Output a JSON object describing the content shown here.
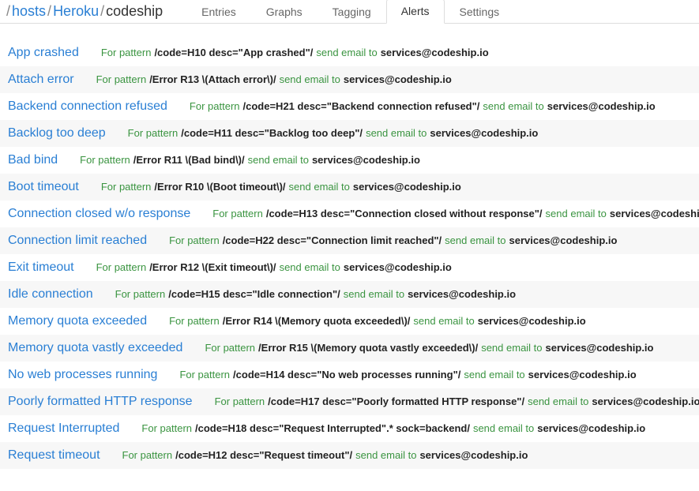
{
  "breadcrumb": {
    "slash": "/",
    "hosts": "hosts",
    "heroku": "Heroku",
    "current": "codeship"
  },
  "tabs": [
    {
      "label": "Entries"
    },
    {
      "label": "Graphs"
    },
    {
      "label": "Tagging"
    },
    {
      "label": "Alerts"
    },
    {
      "label": "Settings"
    }
  ],
  "labels": {
    "for_pattern": "For pattern",
    "send_email_to": "send email to"
  },
  "alerts": [
    {
      "name": "App crashed",
      "pattern": "/code=H10 desc=\"App crashed\"/",
      "email": "services@codeship.io"
    },
    {
      "name": "Attach error",
      "pattern": "/Error R13 \\(Attach error\\)/",
      "email": "services@codeship.io"
    },
    {
      "name": "Backend connection refused",
      "pattern": "/code=H21 desc=\"Backend connection refused\"/",
      "email": "services@codeship.io"
    },
    {
      "name": "Backlog too deep",
      "pattern": "/code=H11 desc=\"Backlog too deep\"/",
      "email": "services@codeship.io"
    },
    {
      "name": "Bad bind",
      "pattern": "/Error R11 \\(Bad bind\\)/",
      "email": "services@codeship.io"
    },
    {
      "name": "Boot timeout",
      "pattern": "/Error R10 \\(Boot timeout\\)/",
      "email": "services@codeship.io"
    },
    {
      "name": "Connection closed w/o response",
      "pattern": "/code=H13 desc=\"Connection closed without response\"/",
      "email": "services@codeship"
    },
    {
      "name": "Connection limit reached",
      "pattern": "/code=H22 desc=\"Connection limit reached\"/",
      "email": "services@codeship.io"
    },
    {
      "name": "Exit timeout",
      "pattern": "/Error R12 \\(Exit timeout\\)/",
      "email": "services@codeship.io"
    },
    {
      "name": "Idle connection",
      "pattern": "/code=H15 desc=\"Idle connection\"/",
      "email": "services@codeship.io"
    },
    {
      "name": "Memory quota exceeded",
      "pattern": "/Error R14 \\(Memory quota exceeded\\)/",
      "email": "services@codeship.io"
    },
    {
      "name": "Memory quota vastly exceeded",
      "pattern": "/Error R15 \\(Memory quota vastly exceeded\\)/",
      "email": "services@codeship.io"
    },
    {
      "name": "No web processes running",
      "pattern": "/code=H14 desc=\"No web processes running\"/",
      "email": "services@codeship.io"
    },
    {
      "name": "Poorly formatted HTTP response",
      "pattern": "/code=H17 desc=\"Poorly formatted HTTP response\"/",
      "email": "services@codeship.io"
    },
    {
      "name": "Request Interrupted",
      "pattern": "/code=H18 desc=\"Request Interrupted\".* sock=backend/",
      "email": "services@codeship.io"
    },
    {
      "name": "Request timeout",
      "pattern": "/code=H12 desc=\"Request timeout\"/",
      "email": "services@codeship.io"
    }
  ]
}
